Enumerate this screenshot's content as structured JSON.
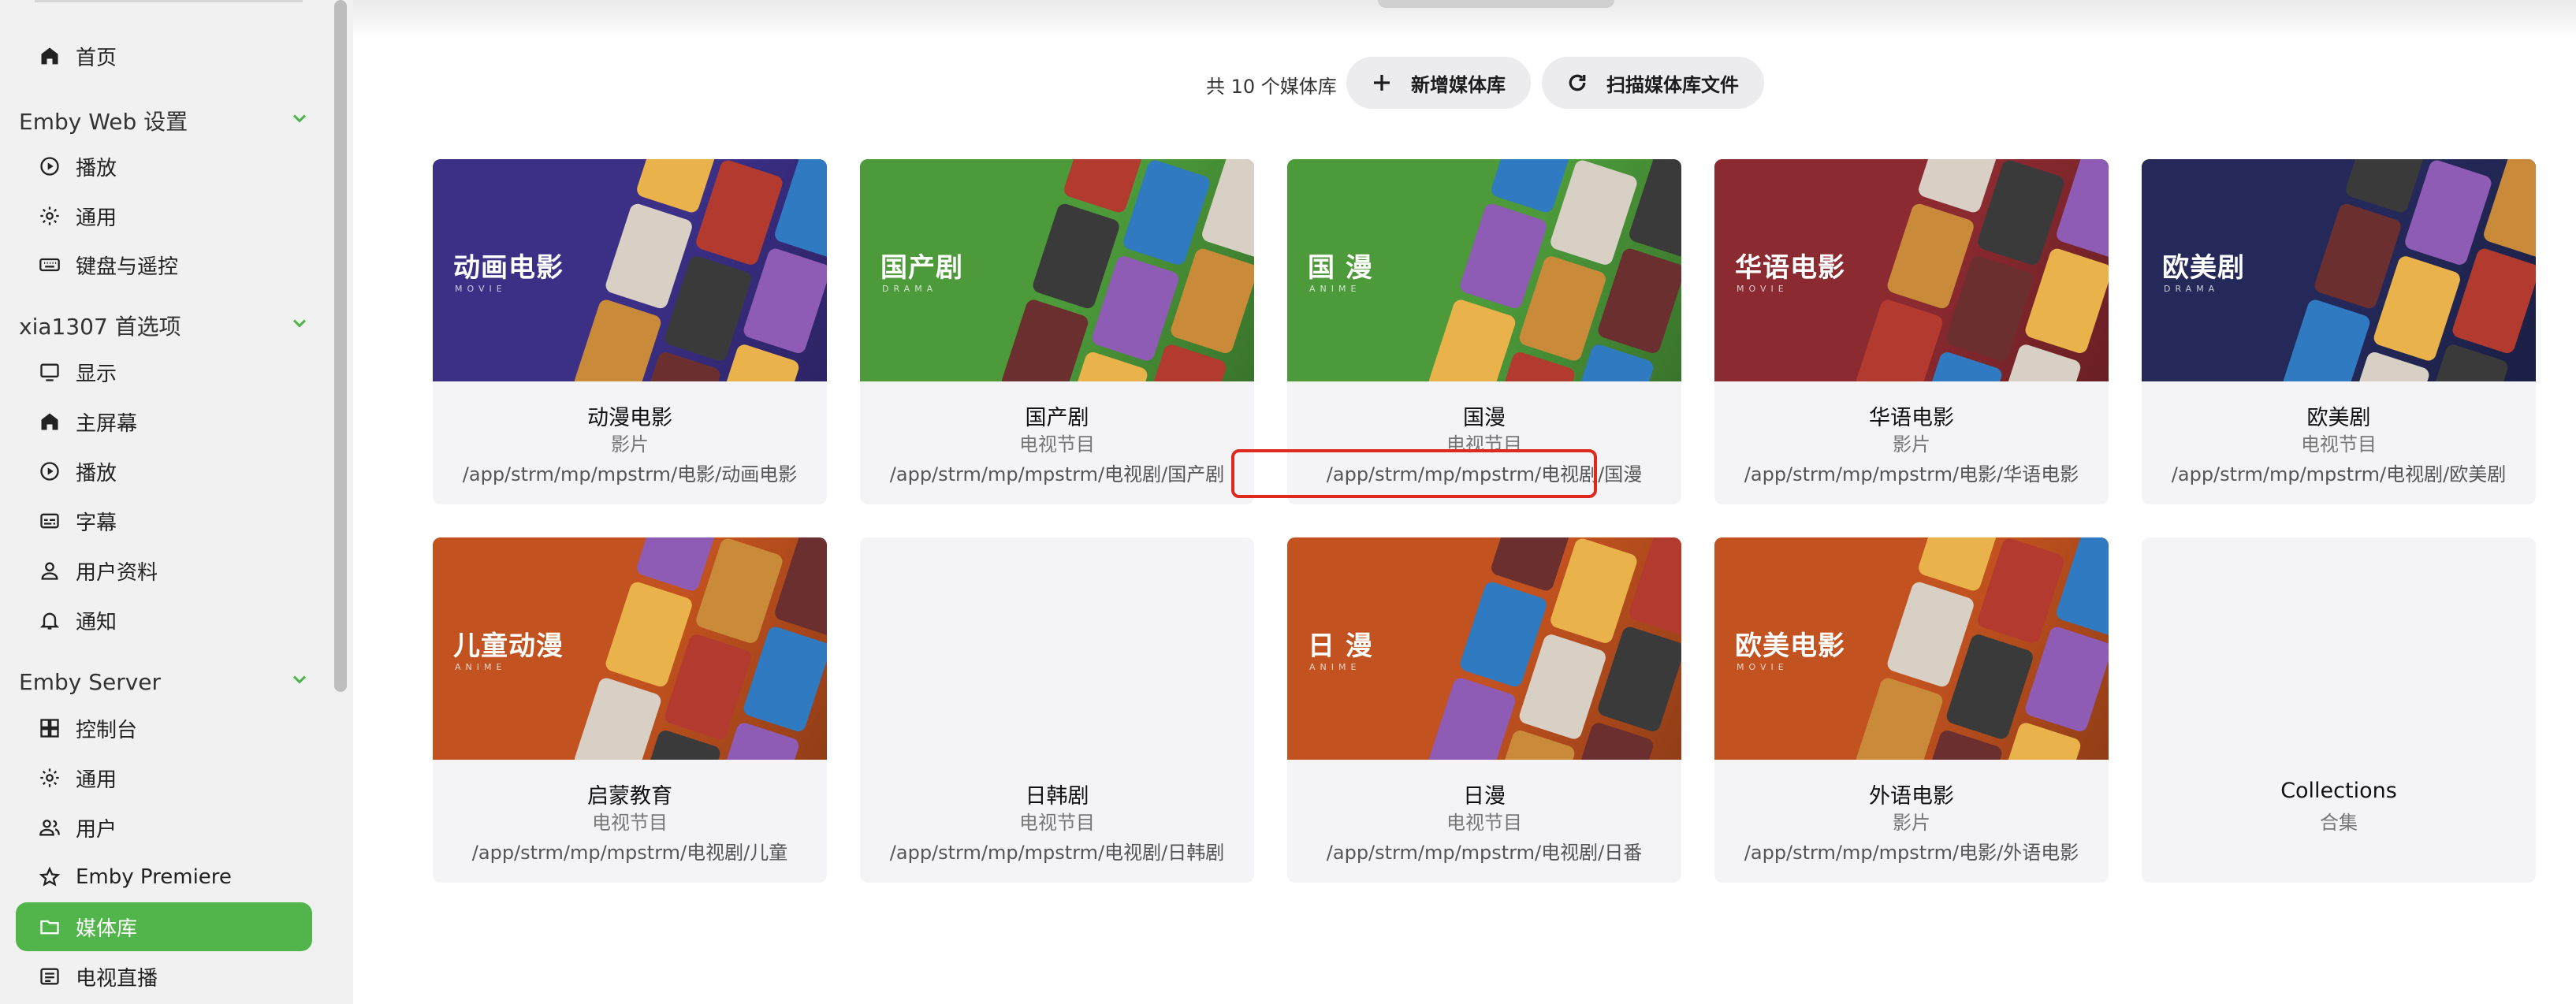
{
  "sidebar": {
    "items": [
      {
        "label": "首页",
        "icon": "home-icon"
      },
      {
        "label": "播放",
        "icon": "play-circle-icon"
      },
      {
        "label": "通用",
        "icon": "gear-icon"
      },
      {
        "label": "键盘与遥控",
        "icon": "keyboard-icon"
      },
      {
        "label": "显示",
        "icon": "monitor-icon"
      },
      {
        "label": "主屏幕",
        "icon": "home-icon"
      },
      {
        "label": "播放",
        "icon": "play-circle-icon"
      },
      {
        "label": "字幕",
        "icon": "subtitles-icon"
      },
      {
        "label": "用户资料",
        "icon": "person-icon"
      },
      {
        "label": "通知",
        "icon": "bell-icon"
      },
      {
        "label": "控制台",
        "icon": "dashboard-icon"
      },
      {
        "label": "通用",
        "icon": "gear-icon"
      },
      {
        "label": "用户",
        "icon": "people-icon"
      },
      {
        "label": "Emby Premiere",
        "icon": "star-icon"
      },
      {
        "label": "媒体库",
        "icon": "folder-icon",
        "active": true
      },
      {
        "label": "电视直播",
        "icon": "tv-guide-icon"
      }
    ],
    "sections": [
      {
        "label": "Emby Web 设置"
      },
      {
        "label": "xia1307 首选项"
      },
      {
        "label": "Emby Server"
      }
    ]
  },
  "toolbar": {
    "count_text": "共 10 个媒体库",
    "add_label": "新增媒体库",
    "scan_label": "扫描媒体库文件"
  },
  "libraries": [
    {
      "name": "动漫电影",
      "type": "影片",
      "path": "/app/strm/mp/mpstrm/电影/动画电影",
      "thumb_title": "动画电影",
      "thumb_sub": "MOVIE",
      "bg": "#3b2f86"
    },
    {
      "name": "国产剧",
      "type": "电视节目",
      "path": "/app/strm/mp/mpstrm/电视剧/国产剧",
      "thumb_title": "国产剧",
      "thumb_sub": "DRAMA",
      "bg": "#4c9a3a"
    },
    {
      "name": "国漫",
      "type": "电视节目",
      "path": "/app/strm/mp/mpstrm/电视剧/国漫",
      "thumb_title": "国 漫",
      "thumb_sub": "ANIME",
      "bg": "#4c9a3a"
    },
    {
      "name": "华语电影",
      "type": "影片",
      "path": "/app/strm/mp/mpstrm/电影/华语电影",
      "thumb_title": "华语电影",
      "thumb_sub": "MOVIE",
      "bg": "#8b2a30"
    },
    {
      "name": "欧美剧",
      "type": "电视节目",
      "path": "/app/strm/mp/mpstrm/电视剧/欧美剧",
      "thumb_title": "欧美剧",
      "thumb_sub": "DRAMA",
      "bg": "#24295a"
    },
    {
      "name": "启蒙教育",
      "type": "电视节目",
      "path": "/app/strm/mp/mpstrm/电视剧/儿童",
      "thumb_title": "儿童动漫",
      "thumb_sub": "ANIME",
      "bg": "#c2521f"
    },
    {
      "name": "日韩剧",
      "type": "电视节目",
      "path": "/app/strm/mp/mpstrm/电视剧/日韩剧",
      "thumb_title": "",
      "thumb_sub": "",
      "bg": "#f4f4f6"
    },
    {
      "name": "日漫",
      "type": "电视节目",
      "path": "/app/strm/mp/mpstrm/电视剧/日番",
      "thumb_title": "日 漫",
      "thumb_sub": "ANIME",
      "bg": "#c2521f"
    },
    {
      "name": "外语电影",
      "type": "影片",
      "path": "/app/strm/mp/mpstrm/电影/外语电影",
      "thumb_title": "欧美电影",
      "thumb_sub": "MOVIE",
      "bg": "#c2521f"
    },
    {
      "name": "Collections",
      "type": "合集",
      "path": "",
      "thumb_title": "",
      "thumb_sub": "",
      "bg": "#f4f4f6"
    }
  ],
  "colors": {
    "accent": "#52b54b",
    "highlight": "#e0291e"
  }
}
